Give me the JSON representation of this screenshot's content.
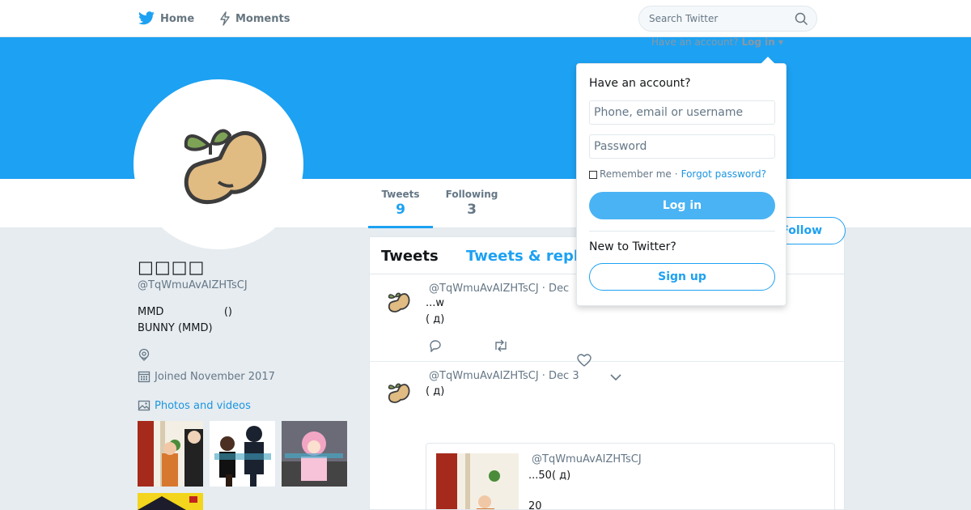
{
  "nav": {
    "home_label": "Home",
    "moments_label": "Moments",
    "search_placeholder": "Search Twitter",
    "have_account_prefix": "Have an account?",
    "login_link": "Log in"
  },
  "profile": {
    "name": "□□□□",
    "handle": "@TqWmuAvAIZHTsCJ",
    "bio_line1": "MMD                  ()",
    "bio_line2": "BUNNY (MMD)",
    "joined": "Joined November 2017",
    "photos_label": "Photos and videos",
    "follow_label": "Follow"
  },
  "stats": {
    "tweets_label": "Tweets",
    "tweets_value": "9",
    "following_label": "Following",
    "following_value": "3"
  },
  "timeline": {
    "tab_tweets": "Tweets",
    "tab_replies": "Tweets & replies",
    "tweets": [
      {
        "header": "@TqWmuAvAIZHTsCJ  · Dec",
        "line1": "...w",
        "line2": "( д)"
      },
      {
        "header": "@TqWmuAvAIZHTsCJ  · Dec 3",
        "line1": "( д)"
      }
    ],
    "quote": {
      "handle": "@TqWmuAvAIZHTsCJ",
      "line1": "...50( д)",
      "line2": "20"
    }
  },
  "login_dropdown": {
    "title": "Have an account?",
    "username_placeholder": "Phone, email or username",
    "password_placeholder": "Password",
    "remember_label": "Remember me",
    "forgot_label": "Forgot password?",
    "login_button": "Log in",
    "new_label": "New to Twitter?",
    "signup_button": "Sign up"
  },
  "colors": {
    "brand": "#1da1f2",
    "login_button": "#4ab3f4",
    "link": "#1b95e0",
    "background": "#e6ecf0"
  }
}
